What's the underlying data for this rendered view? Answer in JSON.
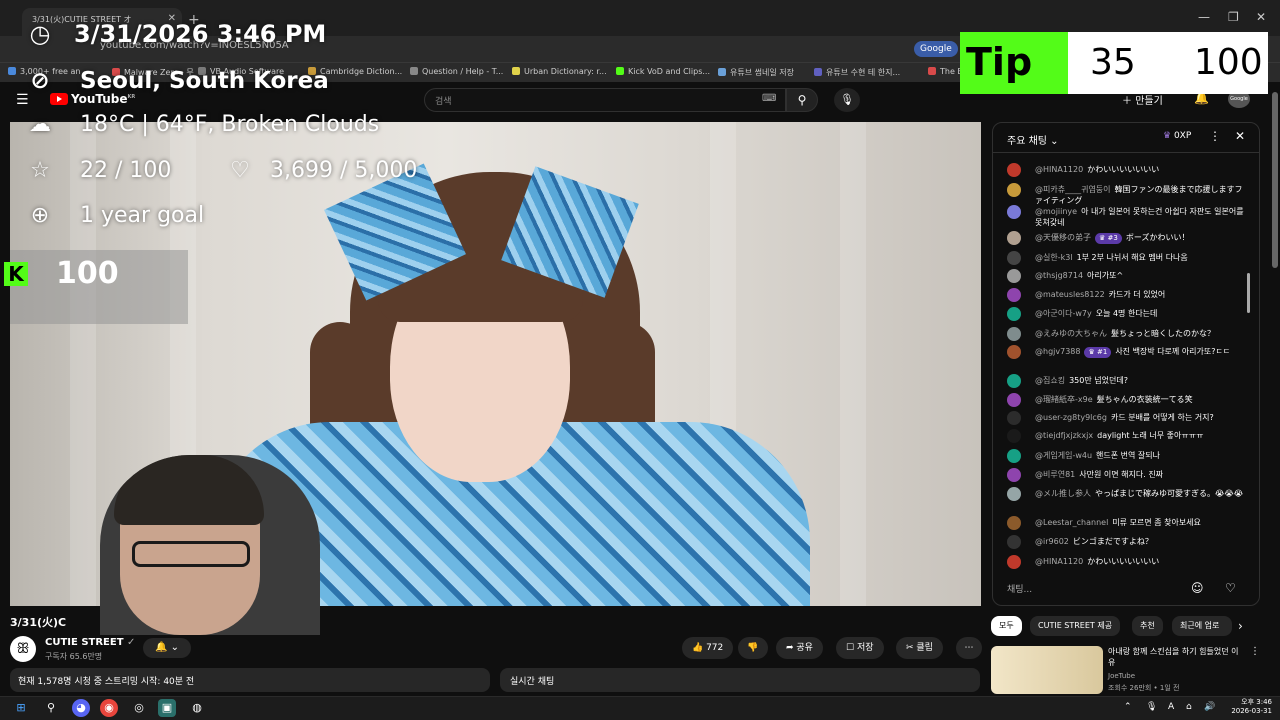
{
  "browser": {
    "tab_title": "3/31(火)CUTIE STREET オ",
    "url": "youtube.com/watch?v=INOESL5N05A",
    "google_button": "Google",
    "bookmarks": [
      {
        "label": "3,000+ free an",
        "color": "#4a89dc"
      },
      {
        "label": "Malware Zero - 무",
        "color": "#d84a4a"
      },
      {
        "label": "VB Audio Software",
        "color": "#7a7a7a"
      },
      {
        "label": "Cambridge Diction...",
        "color": "#c79a3a"
      },
      {
        "label": "Question / Help - T...",
        "color": "#888888"
      },
      {
        "label": "Urban Dictionary: r...",
        "color": "#e0d24a"
      },
      {
        "label": "Kick VoD and Clips...",
        "color": "#53fc18"
      },
      {
        "label": "유튜브 썸네일 저장",
        "color": "#6aa0d8"
      },
      {
        "label": "유튜브 수현 테 한지...",
        "color": "#6060c0"
      },
      {
        "label": "The Best",
        "color": "#d84a4a"
      }
    ]
  },
  "overlay": {
    "datetime": "3/31/2026 3:46 PM",
    "location": "Seoul, South Korea",
    "weather": "18°C | 64°F, Broken Clouds",
    "stars": "22 / 100",
    "hearts": "3,699 / 5,000",
    "goal_label": "1 year goal",
    "goal_value": "100",
    "tip_label": "Tip",
    "tip_current": "35",
    "tip_max": "100"
  },
  "youtube": {
    "logo": "YouTube",
    "logo_suffix": "KR",
    "search_placeholder": "검색",
    "create_label": "만들기",
    "avatar_text": "Google"
  },
  "video": {
    "title": "3/31(火)C",
    "channel_name": "CUTIE STREET",
    "subscribers": "구독자 65.6만명",
    "likes": "772",
    "share_label": "공유",
    "save_label": "저장",
    "clip_label": "클립",
    "description": "현재 1,578명 시청 중 스트리밍 시작: 40분 전",
    "chat_replay_label": "실시간 채팅"
  },
  "chat": {
    "title": "주요 채팅",
    "oxp_label": "0XP",
    "input_placeholder": "채팅...",
    "messages": [
      {
        "user": "@HINA1120",
        "text": "かわいいいいいいい",
        "avatar_color": "#c0392b",
        "badge": ""
      },
      {
        "user": "@피카츄____귀염둥이",
        "text": "韓国ファンの最後まで応援しますファイティング",
        "avatar_color": "#c79a3a",
        "badge": ""
      },
      {
        "user": "@mojiinye",
        "text": "아 내가 일본어 못하는건 아쉽다 자판도 일본어를 못쳐갖네",
        "avatar_color": "#7a7ad8",
        "badge": ""
      },
      {
        "user": "@天優移の弟子",
        "text": "ボーズかわいい！",
        "avatar_color": "#b0a090",
        "badge": "#3"
      },
      {
        "user": "@실한-k3l",
        "text": "1부 2부 나뉘서 해요 멤버 다나옴",
        "avatar_color": "#444444",
        "badge": ""
      },
      {
        "user": "@thsjg8714",
        "text": "아리가또^",
        "avatar_color": "#999999",
        "badge": ""
      },
      {
        "user": "@mateusles8122",
        "text": "카드가 더 있었어",
        "avatar_color": "#8e44ad",
        "badge": ""
      },
      {
        "user": "@아군이다-w7y",
        "text": "오늘 4명 한다는데",
        "avatar_color": "#16a085",
        "badge": ""
      },
      {
        "user": "@えみゆの大ちゃん",
        "text": "髪ちょっと暗くしたのかな？",
        "avatar_color": "#7f8c8d",
        "badge": ""
      },
      {
        "user": "@hgjv7388",
        "text": "사진 백장박 다로께 아리가또?ㄷㄷ",
        "avatar_color": "#a0522d",
        "badge": "#1"
      },
      {
        "user": "@집쇼킹",
        "text": "350만 넘었던데?",
        "avatar_color": "#16a085",
        "badge": ""
      },
      {
        "user": "@瑠緒紙卒-x9e",
        "text": "髪ちゃんの衣装統一てる笑",
        "avatar_color": "#8e44ad",
        "badge": ""
      },
      {
        "user": "@user-zg8ty9lc6g",
        "text": "카드 분배를 어떻게 하는 거지?",
        "avatar_color": "#2c2c2c",
        "badge": ""
      },
      {
        "user": "@tiejdfjxjzkxjx",
        "text": "daylight 노래 너무 좋아ㅠㅠㅠ",
        "avatar_color": "#1a1a1a",
        "badge": ""
      },
      {
        "user": "@게임게임-w4u",
        "text": "핸드폰 번역 잘되나",
        "avatar_color": "#16a085",
        "badge": ""
      },
      {
        "user": "@비루연81",
        "text": "사만원 이면 해지다. 진짜",
        "avatar_color": "#8e44ad",
        "badge": ""
      },
      {
        "user": "@メル推し参人",
        "text": "やっぱまじで稼みゆ可愛すぎる。😭😭😭",
        "avatar_color": "#95a5a6",
        "badge": ""
      },
      {
        "user": "@Leestar_channel",
        "text": "미류 모르면 좀 찾아보세요",
        "avatar_color": "#8b5a2b",
        "badge": ""
      },
      {
        "user": "@ir9602",
        "text": "ビンゴまだですよね？",
        "avatar_color": "#333333",
        "badge": ""
      },
      {
        "user": "@HINA1120",
        "text": "かわいいいいいいい",
        "avatar_color": "#c0392b",
        "badge": ""
      }
    ]
  },
  "recommendations": {
    "chips": [
      "모두",
      "CUTIE STREET 제공",
      "추천",
      "최근에 업로"
    ],
    "item": {
      "title": "아내랑 함께 스킨십을 하기 힘들었던 이유",
      "channel": "JoeTube",
      "meta": "조회수 26만회 • 1일 전"
    }
  },
  "taskbar": {
    "lang": "A",
    "time": "오후 3:46",
    "date": "2026-03-31"
  }
}
